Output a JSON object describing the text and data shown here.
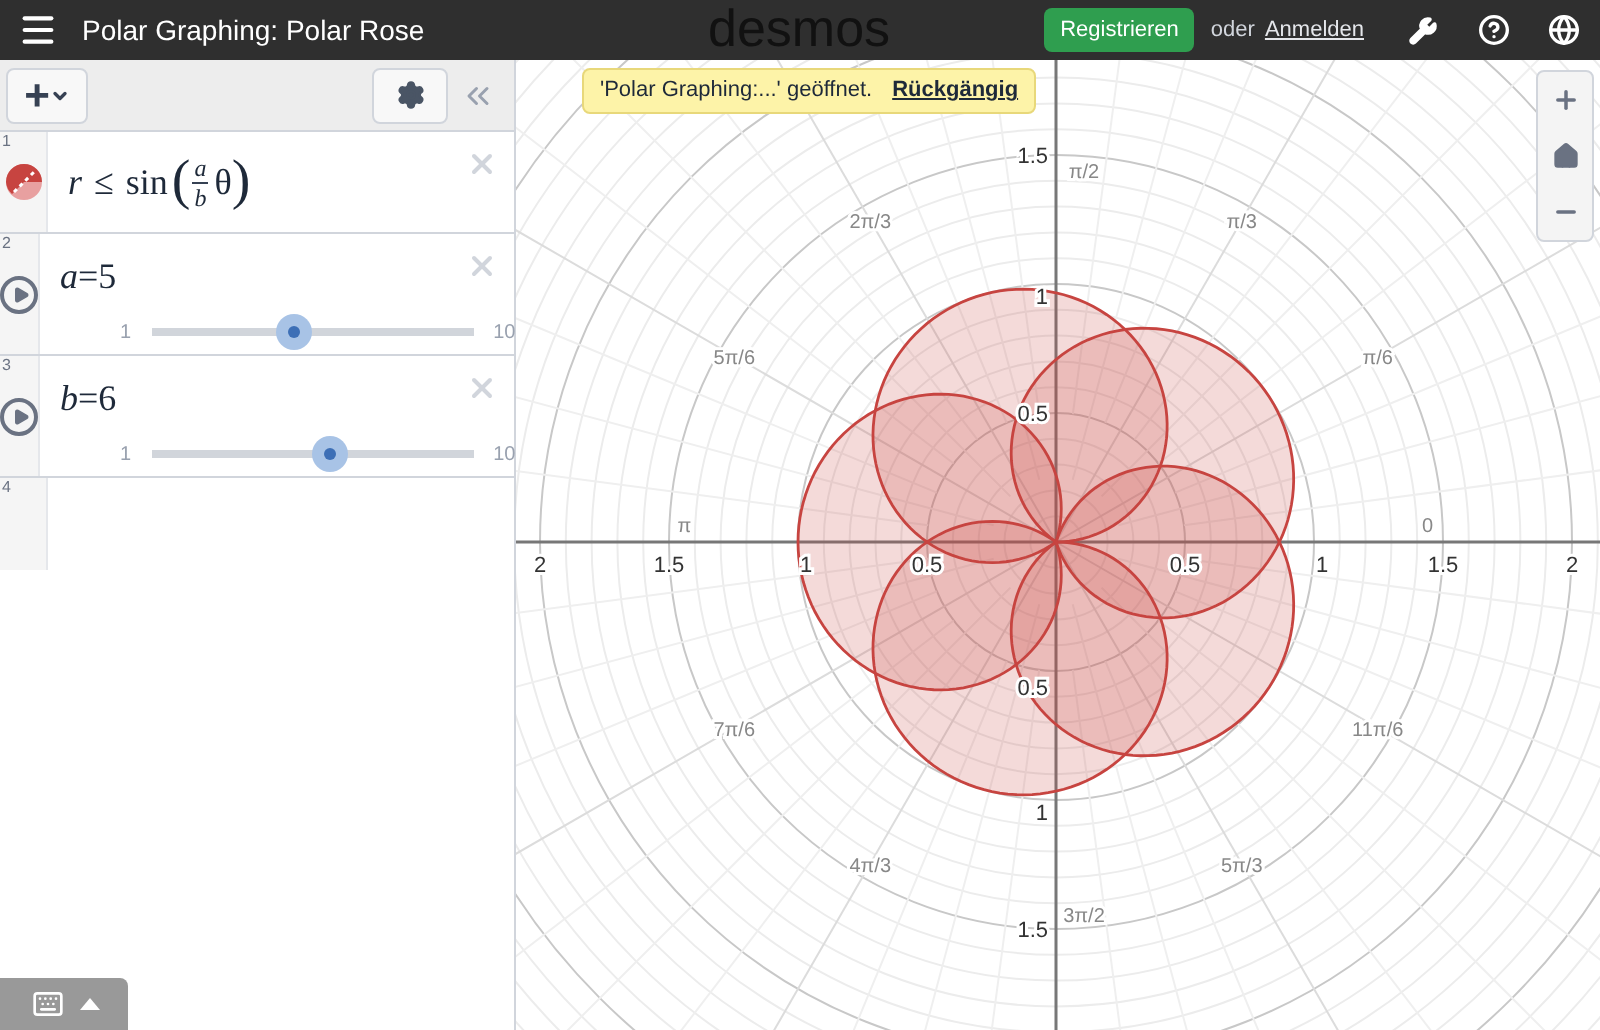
{
  "header": {
    "title": "Polar Graphing: Polar Rose",
    "logo": "desmos",
    "register": "Registrieren",
    "or": "oder",
    "login": "Anmelden"
  },
  "toolbar": {
    "add": "+"
  },
  "expressions": [
    {
      "kind": "inequality",
      "index": "1",
      "lhs": "r",
      "op": "≤",
      "func": "sin",
      "open": "(",
      "numerator": "a",
      "denominator": "b",
      "arg": "θ",
      "close": ")"
    },
    {
      "kind": "slider",
      "index": "2",
      "name": "a",
      "eq": "=",
      "value": "5",
      "min": "1",
      "max": "10",
      "level": 0.444
    },
    {
      "kind": "slider",
      "index": "3",
      "name": "b",
      "eq": "=",
      "value": "6",
      "min": "1",
      "max": "10",
      "level": 0.556
    },
    {
      "kind": "empty",
      "index": "4"
    }
  ],
  "toast": {
    "message": "'Polar Graphing:...' geöffnet.",
    "undo": "Rückgängig"
  },
  "graph": {
    "x_tick_labels": [
      "2",
      "1.5",
      "1",
      "0.5",
      "0.5",
      "1",
      "1.5",
      "2"
    ],
    "y_tick_labels": [
      "1.5",
      "1",
      "0.5",
      "0.5",
      "1",
      "1.5"
    ],
    "angle_labels": [
      "0",
      "π/6",
      "π/3",
      "π/2",
      "2π/3",
      "5π/6",
      "π",
      "7π/6",
      "4π/3",
      "3π/2",
      "5π/3",
      "11π/6"
    ]
  }
}
